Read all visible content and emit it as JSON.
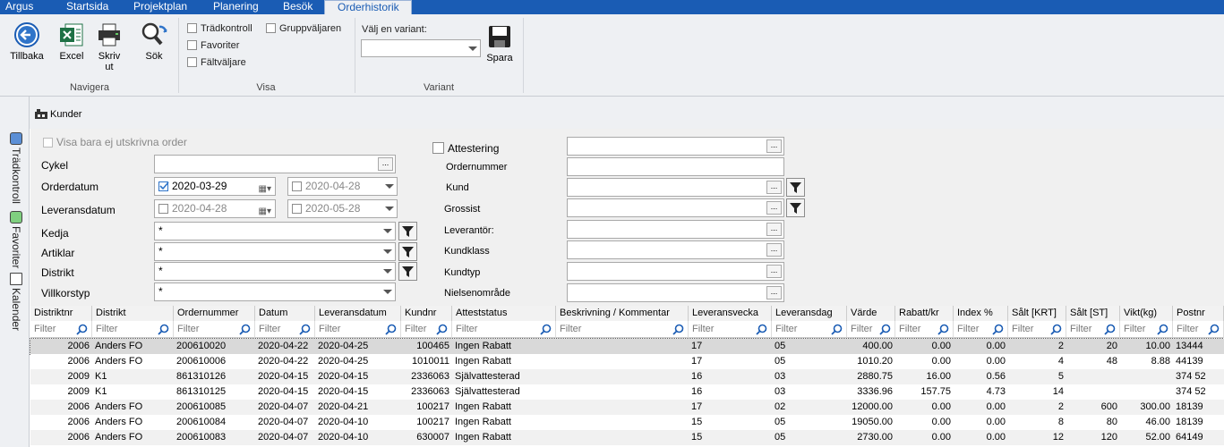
{
  "menu": {
    "tabs": [
      "Argus",
      "Startsida",
      "Projektplan",
      "Planering",
      "Besök",
      "Orderhistorik"
    ]
  },
  "ribbon": {
    "navigera": {
      "back": "Tillbaka",
      "excel": "Excel",
      "print": "Skriv ut",
      "search": "Sök",
      "group": "Navigera"
    },
    "visa": {
      "tradkontroll": "Trädkontroll",
      "favoriter": "Favoriter",
      "faltvaljare": "Fältväljare",
      "gruppvaljaren": "Gruppväljaren",
      "group": "Visa"
    },
    "variant": {
      "label": "Välj en variant:",
      "save": "Spara",
      "group": "Variant"
    }
  },
  "subbar": {
    "kunder": "Kunder"
  },
  "sidebar": {
    "tradkontroll": "Trädkontroll",
    "favoriter": "Favoriter",
    "kalender": "Kalender"
  },
  "filters": {
    "only_unprinted": "Visa bara ej utskrivna order",
    "cykel": "Cykel",
    "orderdatum": "Orderdatum",
    "orderdatum_from": "2020-03-29",
    "orderdatum_to": "2020-04-28",
    "leveransdatum": "Leveransdatum",
    "leveransdatum_from": "2020-04-28",
    "leveransdatum_to": "2020-05-28",
    "kedja": "Kedja",
    "artiklar": "Artiklar",
    "distrikt": "Distrikt",
    "villkorstyp": "Villkorstyp",
    "star": "*",
    "attestering": "Attestering",
    "ordernummer": "Ordernummer",
    "kund": "Kund",
    "grossist": "Grossist",
    "leverantor": "Leverantör:",
    "kundklass": "Kundklass",
    "kundtyp": "Kundtyp",
    "nielsenomrade": "Nielsenområde",
    "dots": "..."
  },
  "grid": {
    "filter_placeholder": "Filter",
    "columns": [
      "Distriktnr",
      "Distrikt",
      "Ordernummer",
      "Datum",
      "Leveransdatum",
      "Kundnr",
      "Atteststatus",
      "Beskrivning / Kommentar",
      "Leveransvecka",
      "Leveransdag",
      "Värde",
      "Rabatt/kr",
      "Index %",
      "Sålt [KRT]",
      "Sålt [ST]",
      "Vikt(kg)",
      "Postnr"
    ],
    "rows": [
      [
        "2006",
        "Anders FO",
        "200610020",
        "2020-04-22",
        "2020-04-25",
        "100465",
        "Ingen Rabatt",
        "",
        "17",
        "05",
        "400.00",
        "0.00",
        "0.00",
        "2",
        "20",
        "10.00",
        "13444"
      ],
      [
        "2006",
        "Anders FO",
        "200610006",
        "2020-04-22",
        "2020-04-25",
        "1010011",
        "Ingen Rabatt",
        "",
        "17",
        "05",
        "1010.20",
        "0.00",
        "0.00",
        "4",
        "48",
        "8.88",
        "44139"
      ],
      [
        "2009",
        "K1",
        "861310126",
        "2020-04-15",
        "2020-04-15",
        "2336063",
        "Självattesterad",
        "",
        "16",
        "03",
        "2880.75",
        "16.00",
        "0.56",
        "5",
        "",
        "",
        "374 52"
      ],
      [
        "2009",
        "K1",
        "861310125",
        "2020-04-15",
        "2020-04-15",
        "2336063",
        "Självattesterad",
        "",
        "16",
        "03",
        "3336.96",
        "157.75",
        "4.73",
        "14",
        "",
        "",
        "374 52"
      ],
      [
        "2006",
        "Anders FO",
        "200610085",
        "2020-04-07",
        "2020-04-21",
        "100217",
        "Ingen Rabatt",
        "",
        "17",
        "02",
        "12000.00",
        "0.00",
        "0.00",
        "2",
        "600",
        "300.00",
        "18139"
      ],
      [
        "2006",
        "Anders FO",
        "200610084",
        "2020-04-07",
        "2020-04-10",
        "100217",
        "Ingen Rabatt",
        "",
        "15",
        "05",
        "19050.00",
        "0.00",
        "0.00",
        "8",
        "80",
        "46.00",
        "18139"
      ],
      [
        "2006",
        "Anders FO",
        "200610083",
        "2020-04-07",
        "2020-04-10",
        "630007",
        "Ingen Rabatt",
        "",
        "15",
        "05",
        "2730.00",
        "0.00",
        "0.00",
        "12",
        "120",
        "52.00",
        "64149"
      ]
    ]
  }
}
